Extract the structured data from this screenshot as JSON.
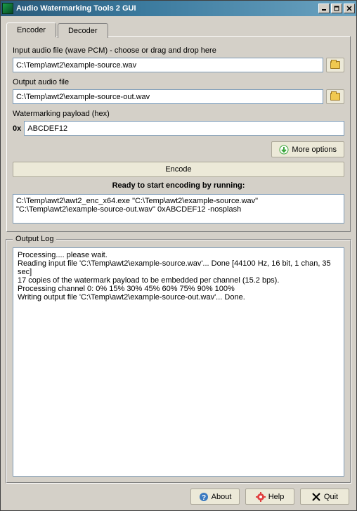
{
  "window": {
    "title": "Audio Watermarking Tools 2 GUI"
  },
  "tabs": {
    "encoder": "Encoder",
    "decoder": "Decoder"
  },
  "encoder": {
    "input_label": "Input audio file (wave PCM) - choose or drag and drop here",
    "input_value": "C:\\Temp\\awt2\\example-source.wav",
    "output_label": "Output audio file",
    "output_value": "C:\\Temp\\awt2\\example-source-out.wav",
    "payload_label": "Watermarking payload (hex)",
    "payload_prefix": "0x",
    "payload_value": "ABCDEF12",
    "more_options": "More options",
    "encode_button": "Encode",
    "status_heading": "Ready to start encoding by running:",
    "command": "C:\\Temp\\awt2\\awt2_enc_x64.exe \"C:\\Temp\\awt2\\example-source.wav\" \"C:\\Temp\\awt2\\example-source-out.wav\" 0xABCDEF12 -nosplash"
  },
  "output_log": {
    "title": "Output Log",
    "text": "Processing.... please wait.\nReading input file 'C:\\Temp\\awt2\\example-source.wav'... Done [44100 Hz, 16 bit, 1 chan, 35 sec]\n17 copies of the watermark payload to be embedded per channel (15.2 bps).\nProcessing channel 0: 0% 15% 30% 45% 60% 75% 90% 100%\nWriting output file 'C:\\Temp\\awt2\\example-source-out.wav'... Done."
  },
  "footer": {
    "about": "About",
    "help": "Help",
    "quit": "Quit"
  },
  "icons": {
    "down_arrow": "⬇",
    "about": "?",
    "help": "✦",
    "quit": "✖"
  },
  "colors": {
    "accent_green": "#3aa63a",
    "accent_blue": "#2a5a7a",
    "folder": "#f0c850"
  }
}
